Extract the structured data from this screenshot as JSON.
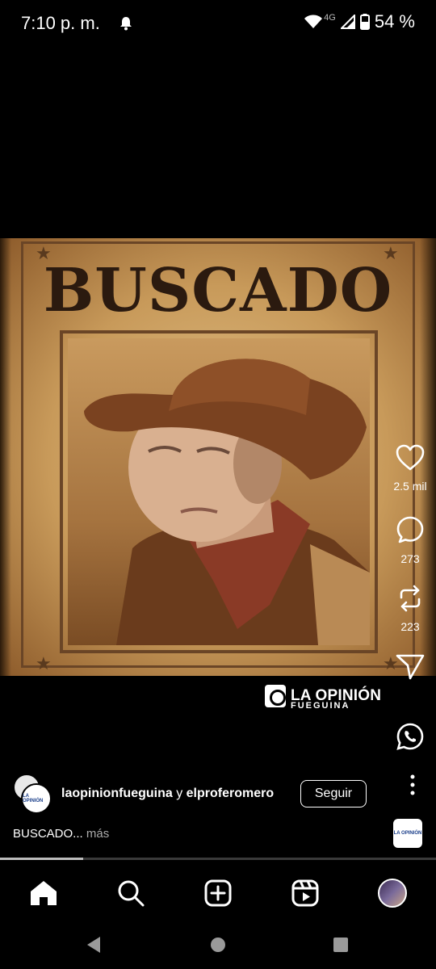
{
  "status_bar": {
    "time": "7:10 p. m.",
    "network_type": "4G",
    "battery_percent": "54 %",
    "icons": [
      "notification-bell-icon",
      "wifi-icon",
      "cell-signal-icon",
      "battery-icon"
    ]
  },
  "post": {
    "poster_title": "BUSCADO",
    "brand": {
      "name": "LA OPINIÓN",
      "sub": "FUEGUINA"
    },
    "actions": {
      "likes": "2.5 mil",
      "comments": "273",
      "reposts": "223"
    },
    "author": {
      "names_primary": "laopinionfueguina",
      "joiner": " y ",
      "names_secondary": "elproferomero",
      "follow_label": "Seguir"
    },
    "caption": {
      "text": "BUSCADO...",
      "more_label": " más"
    },
    "progress": 0.19
  },
  "bottom_nav": {
    "items": [
      "home-icon",
      "search-icon",
      "create-icon",
      "reels-icon",
      "profile-avatar"
    ]
  },
  "system_nav": {
    "items": [
      "back-icon",
      "home-circle-icon",
      "recents-icon"
    ]
  },
  "colors": {
    "background": "#000000",
    "text": "#ffffff",
    "muted": "#aaaaaa",
    "poster_ink": "#2b1a0f"
  }
}
